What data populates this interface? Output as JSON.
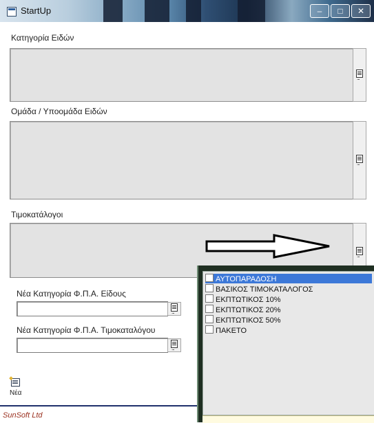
{
  "window": {
    "title": "StartUp",
    "controls": [
      "–",
      "□",
      "✕"
    ]
  },
  "sections": {
    "categories_label": "Κατηγορία Ειδών",
    "groups_label": "Ομάδα / Υποομάδα Ειδών",
    "pricelists_label": "Τιμοκατάλογοι",
    "vat_item_label": "Νέα Κατηγορία Φ.Π.Α. Είδους",
    "vat_item_value": "",
    "vat_pricelist_label": "Νέα Κατηγορία Φ.Π.Α. Τιμοκαταλόγου",
    "vat_pricelist_value": ""
  },
  "pricelist_popup": {
    "items": [
      {
        "label": "ΑΥΤΟΠΑΡΑΔΟΣΗ",
        "selected": true
      },
      {
        "label": "ΒΑΣΙΚΟΣ ΤΙΜΟΚΑΤΑΛΟΓΟΣ",
        "selected": false
      },
      {
        "label": "ΕΚΠΤΩΤΙΚΟΣ 10%",
        "selected": false
      },
      {
        "label": "ΕΚΠΤΩΤΙΚΟΣ 20%",
        "selected": false
      },
      {
        "label": "ΕΚΠΤΩΤΙΚΟΣ 50%",
        "selected": false
      },
      {
        "label": "ΠΑΚΕΤΟ",
        "selected": false
      }
    ]
  },
  "toolbar": {
    "new_label": "Νέα",
    "new_icon": "new-document-icon"
  },
  "footer": {
    "company": "SunSoft Ltd"
  },
  "colors": {
    "selection": "#3c78d8",
    "footer_text": "#9a2f1e",
    "accent_line": "#1f2f6b"
  }
}
